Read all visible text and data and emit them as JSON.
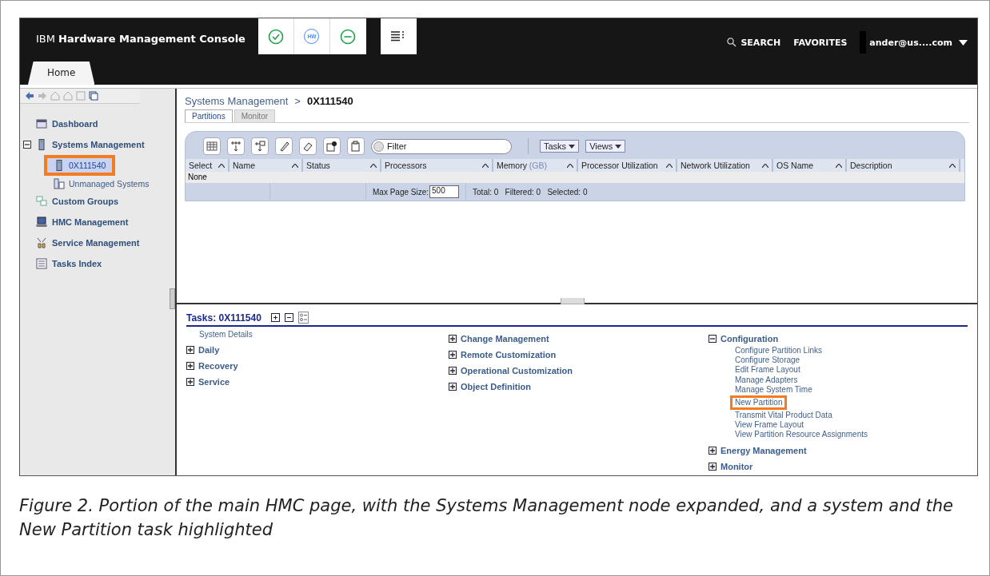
{
  "header": {
    "title_prefix": "IBM",
    "title": "Hardware Management Console",
    "status_icons": [
      {
        "kind": "check"
      },
      {
        "kind": "hw",
        "label": "HW"
      },
      {
        "kind": "minus"
      }
    ],
    "search": "SEARCH",
    "favorites": "FAVORITES",
    "user": "ander@us....com"
  },
  "main_tabs": [
    {
      "label": "Home",
      "selected": true
    }
  ],
  "sidebar": {
    "items": [
      {
        "label": "Dashboard",
        "selected": false
      },
      {
        "label": "Systems Management",
        "expanded": true,
        "selected": false,
        "children": [
          {
            "label": "0X111540",
            "selected": true,
            "highlighted": true
          },
          {
            "label": "Unmanaged Systems",
            "selected": false,
            "highlighted": false
          }
        ]
      },
      {
        "label": "Custom Groups",
        "selected": false
      },
      {
        "label": "HMC Management",
        "selected": false
      },
      {
        "label": "Service Management",
        "selected": false
      },
      {
        "label": "Tasks Index",
        "selected": false
      }
    ]
  },
  "breadcrumb": {
    "parent": "Systems Management",
    "separator": ">",
    "current": "0X111540"
  },
  "tabs": [
    {
      "label": "Partitions",
      "selected": true
    },
    {
      "label": "Monitor",
      "selected": false
    }
  ],
  "toolbar": {
    "filter_placeholder": "Filter",
    "menus": [
      "Tasks",
      "Views"
    ]
  },
  "table": {
    "columns": [
      {
        "label": "Select"
      },
      {
        "label": "Name"
      },
      {
        "label": "Status"
      },
      {
        "label": "Processors"
      },
      {
        "label": "Memory",
        "unit": "(GB)"
      },
      {
        "label": "Processor Utilization"
      },
      {
        "label": "Network Utilization"
      },
      {
        "label": "OS Name"
      },
      {
        "label": "Description"
      }
    ],
    "select_row": "None",
    "page_size_label": "Max Page Size:",
    "page_size": "500",
    "totals": "Total: 0   Filtered: 0   Selected: 0"
  },
  "tasks": {
    "title": "Tasks: 0X111540",
    "columns": [
      [
        {
          "label": "System Details",
          "kind": "link"
        },
        {
          "label": "Daily",
          "kind": "group",
          "expanded": false
        },
        {
          "label": "Recovery",
          "kind": "group",
          "expanded": false
        },
        {
          "label": "Service",
          "kind": "group",
          "expanded": false
        }
      ],
      [
        {
          "label": "Change Management",
          "kind": "group",
          "expanded": false
        },
        {
          "label": "Remote Customization",
          "kind": "group",
          "expanded": false
        },
        {
          "label": "Operational Customization",
          "kind": "group",
          "expanded": false
        },
        {
          "label": "Object Definition",
          "kind": "group",
          "expanded": false
        }
      ],
      [
        {
          "label": "Configuration",
          "kind": "group",
          "expanded": true,
          "children": [
            {
              "label": "Configure Partition Links",
              "highlighted": false
            },
            {
              "label": "Configure Storage",
              "highlighted": false
            },
            {
              "label": "Edit Frame Layout",
              "highlighted": false
            },
            {
              "label": "Manage Adapters",
              "highlighted": false
            },
            {
              "label": "Manage System Time",
              "highlighted": false
            },
            {
              "label": "New Partition",
              "highlighted": true
            },
            {
              "label": "Transmit Vital Product Data",
              "highlighted": false
            },
            {
              "label": "View Frame Layout",
              "highlighted": false
            },
            {
              "label": "View Partition Resource Assignments",
              "highlighted": false
            }
          ]
        },
        {
          "label": "Energy Management",
          "kind": "group",
          "expanded": false
        },
        {
          "label": "Monitor",
          "kind": "group",
          "expanded": false
        }
      ]
    ]
  },
  "caption": "Figure 2. Portion of the main HMC page, with the Systems Management node expanded, and a system and the New Partition task highlighted"
}
